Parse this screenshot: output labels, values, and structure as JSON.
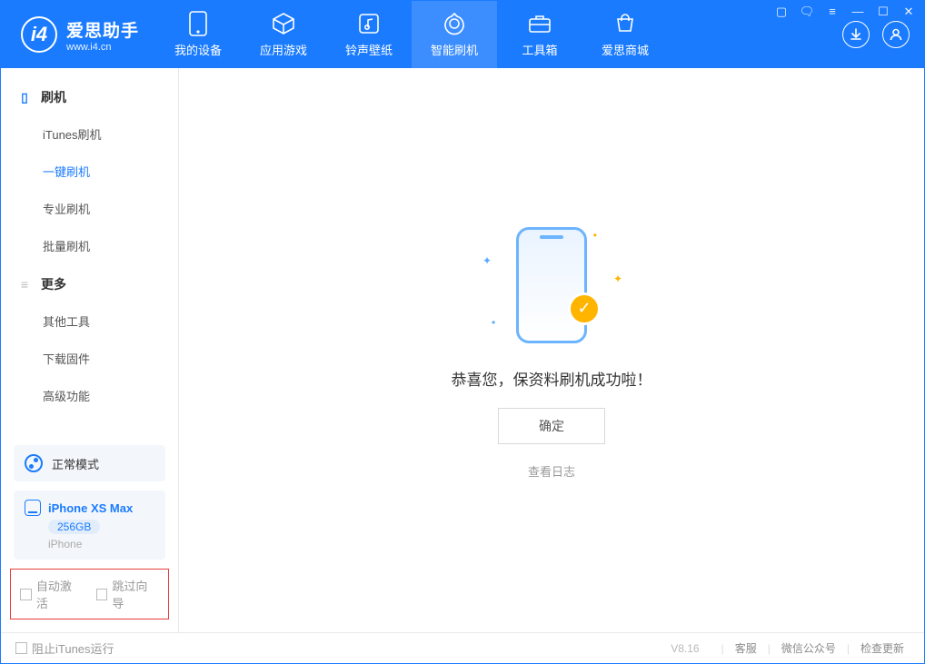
{
  "app": {
    "name": "爱思助手",
    "url": "www.i4.cn"
  },
  "topTabs": {
    "device": "我的设备",
    "apps": "应用游戏",
    "ring": "铃声壁纸",
    "flash": "智能刷机",
    "toolbox": "工具箱",
    "store": "爱思商城"
  },
  "sidebar": {
    "sec1": "刷机",
    "items1": {
      "itunes": "iTunes刷机",
      "oneKey": "一键刷机",
      "pro": "专业刷机",
      "batch": "批量刷机"
    },
    "sec2": "更多",
    "items2": {
      "other": "其他工具",
      "firmware": "下载固件",
      "advanced": "高级功能"
    }
  },
  "mode": "正常模式",
  "device": {
    "name": "iPhone XS Max",
    "capacity": "256GB",
    "type": "iPhone"
  },
  "checks": {
    "autoActivate": "自动激活",
    "skipGuide": "跳过向导"
  },
  "main": {
    "successText": "恭喜您，保资料刷机成功啦！",
    "okBtn": "确定",
    "viewLog": "查看日志"
  },
  "footer": {
    "blockItunes": "阻止iTunes运行",
    "version": "V8.16",
    "support": "客服",
    "wechat": "微信公众号",
    "update": "检查更新"
  }
}
